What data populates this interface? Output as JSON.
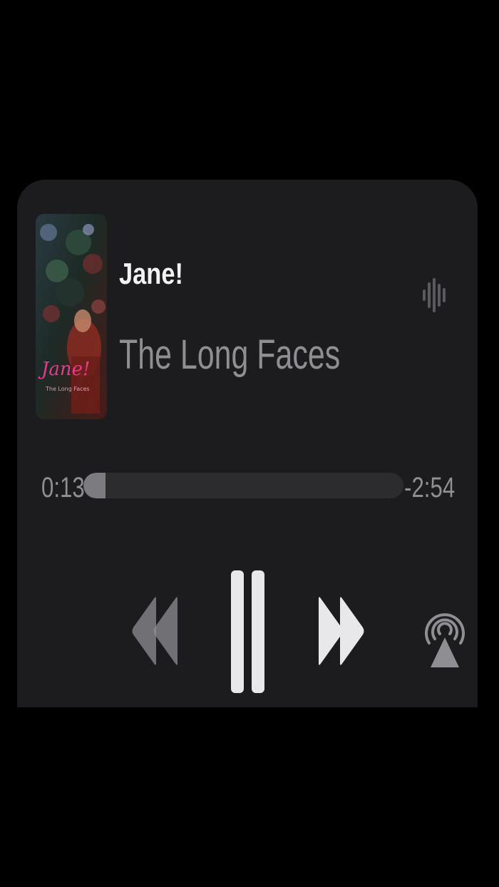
{
  "track": {
    "title": "Jane!",
    "artist": "The Long Faces",
    "album_art_text": "Jane!"
  },
  "playback": {
    "elapsed": "0:13",
    "remaining": "-2:54",
    "progress": 0.07,
    "state": "playing"
  },
  "controls": {
    "rewind_icon": "rewind-icon",
    "pause_icon": "pause-icon",
    "forward_icon": "fast-forward-icon",
    "airplay_icon": "airplay-icon",
    "waveform_icon": "waveform-icon"
  },
  "colors": {
    "background": "#000000",
    "card": "#1c1c1e",
    "primary_text": "#f2f2f2",
    "secondary_text": "#8e8e93",
    "progress_fill": "#7c7c80",
    "progress_track": "#2c2c2e",
    "accent_pink": "#e23c8a"
  }
}
